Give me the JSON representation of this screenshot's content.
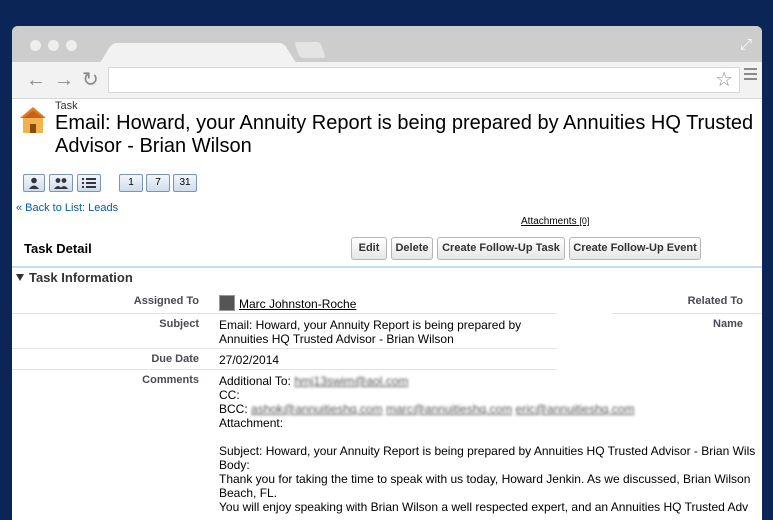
{
  "page_type": "Task",
  "title": "Email: Howard, your Annuity Report is being prepared by Annuities HQ Trusted Advisor - Brian Wilson",
  "view_buttons": [
    "1",
    "7",
    "31"
  ],
  "back_link": "« Back to List: Leads",
  "attachments_label": "Attachments",
  "attachments_count": "[0]",
  "detail_title": "Task Detail",
  "buttons": {
    "edit": "Edit",
    "delete": "Delete",
    "follow_task": "Create Follow-Up Task",
    "follow_event": "Create Follow-Up Event"
  },
  "section_title": "Task Information",
  "fields": {
    "assigned_to_label": "Assigned To",
    "assigned_to": "Marc Johnston-Roche",
    "related_to_label": "Related To",
    "subject_label": "Subject",
    "subject_line1": "Email: Howard, your Annuity Report is being prepared by",
    "subject_line2": "Annuities HQ Trusted Advisor - Brian Wilson",
    "name_label": "Name",
    "due_date_label": "Due Date",
    "due_date": "27/02/2014",
    "comments_label": "Comments"
  },
  "comments": {
    "additional_to_label": "Additional To:",
    "additional_to": "hmj13swim@aol.com",
    "cc": "CC:",
    "bcc_label": "BCC:",
    "bcc_1": "ashok@annuitieshq.com",
    "bcc_2": "marc@annuitieshq.com",
    "bcc_3": "eric@annuitieshq.com",
    "attachment": "Attachment:",
    "subject": "Subject: Howard, your Annuity Report is being prepared by Annuities HQ Trusted Advisor - Brian Wils",
    "body_label": "Body:",
    "body_1": "Thank you for taking the time to speak with us today, Howard Jenkin. As we discussed, Brian Wilson",
    "body_2": "Beach, FL.",
    "body_3": "You will enjoy speaking with Brian Wilson a well respected expert, and an Annuities HQ Trusted Adv"
  }
}
